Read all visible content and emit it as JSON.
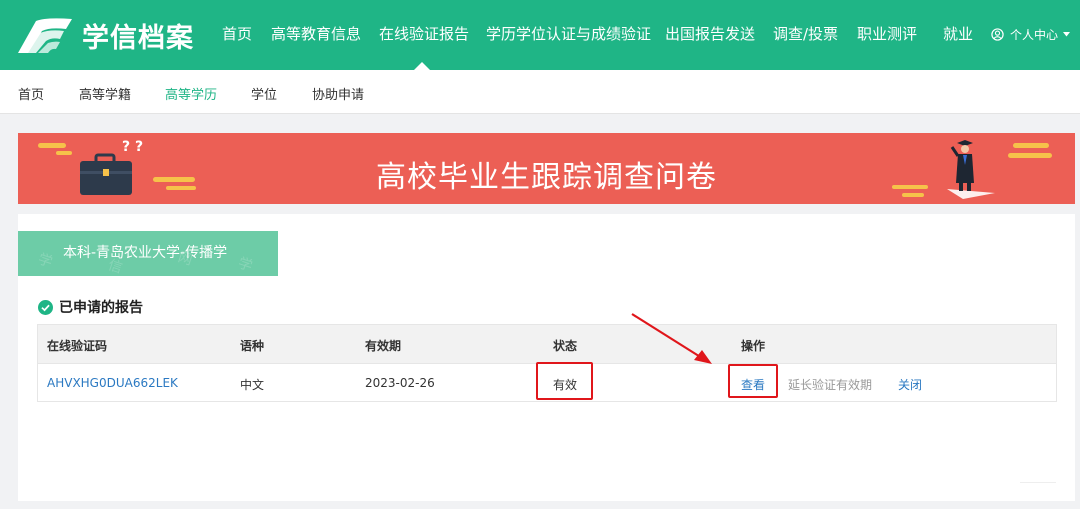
{
  "logo": {
    "text": "学信档案"
  },
  "topnav": {
    "items": [
      "首页",
      "高等教育信息",
      "在线验证报告",
      "学历学位认证与成绩验证",
      "出国报告发送",
      "调查/投票",
      "职业测评",
      "就业"
    ],
    "active": "在线验证报告",
    "user_label": "个人中心"
  },
  "subnav": {
    "items": [
      "首页",
      "高等学籍",
      "高等学历",
      "学位",
      "协助申请"
    ],
    "active": "高等学历"
  },
  "banner": {
    "title": "高校毕业生跟踪调查问卷"
  },
  "degree_tab": {
    "label": "本科-青岛农业大学-传播学"
  },
  "section": {
    "title": "已申请的报告"
  },
  "table": {
    "headers": [
      "在线验证码",
      "语种",
      "有效期",
      "状态",
      "操作"
    ],
    "row": {
      "code": "AHVXHG0DUA662LEK",
      "language": "中文",
      "expiry": "2023-02-26",
      "status": "有效",
      "actions": {
        "view": "查看",
        "extend": "延长验证有效期",
        "close": "关闭"
      }
    }
  },
  "colors": {
    "brand": "#1fb586",
    "banner": "#ec5f55",
    "link": "#2b79c2",
    "highlight": "#e0161b"
  },
  "icons": [
    "logo-book-icon",
    "user-circle-icon",
    "caret-down-icon",
    "check-circle-icon",
    "briefcase-icon",
    "graduate-icon",
    "arrow-annotation-icon"
  ]
}
